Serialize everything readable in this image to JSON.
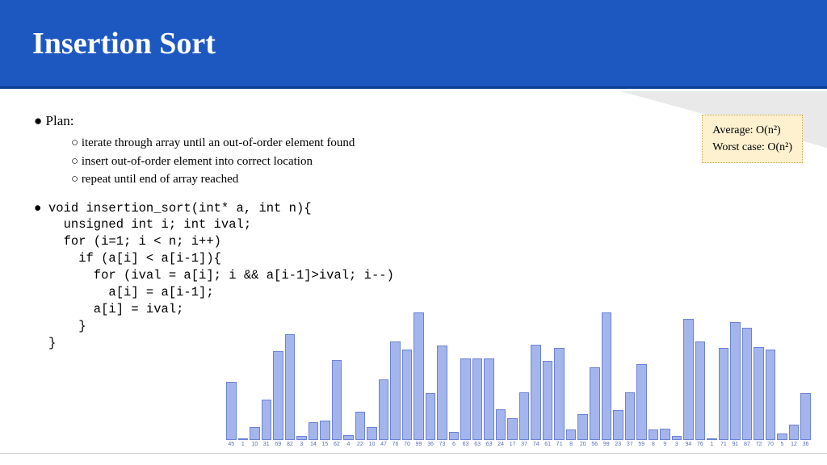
{
  "header": {
    "title": "Insertion Sort"
  },
  "plan": {
    "heading": "Plan:",
    "items": [
      "iterate through array until an out-of-order element found",
      "insert out-of-order element into correct location",
      "repeat until end of array reached"
    ]
  },
  "code": {
    "line1": "void insertion_sort(int* a, int n){",
    "line2": "  unsigned int i; int ival;",
    "line3": "  for (i=1; i < n; i++)",
    "line4": "    if (a[i] < a[i-1]){",
    "line5": "      for (ival = a[i]; i && a[i-1]>ival; i--)",
    "line6": "        a[i] = a[i-1];",
    "line7": "      a[i] = ival;",
    "line8": "    }",
    "line9": "}"
  },
  "complexity": {
    "avg": "Average: O(n²)",
    "worst": "Worst case: O(n²)"
  },
  "chart_data": {
    "type": "bar",
    "title": "",
    "xlabel": "",
    "ylabel": "",
    "ylim": [
      0,
      100
    ],
    "categories": [
      "45",
      "1",
      "10",
      "31",
      "69",
      "82",
      "3",
      "14",
      "15",
      "62",
      "4",
      "22",
      "10",
      "47",
      "76",
      "70",
      "99",
      "36",
      "73",
      "6",
      "63",
      "63",
      "63",
      "24",
      "17",
      "37",
      "74",
      "61",
      "71",
      "8",
      "20",
      "56",
      "99",
      "23",
      "37",
      "59",
      "8",
      "9",
      "3",
      "94",
      "76",
      "1",
      "71",
      "91",
      "87",
      "72",
      "70",
      "5",
      "12",
      "36"
    ],
    "values": [
      45,
      1,
      10,
      31,
      69,
      82,
      3,
      14,
      15,
      62,
      4,
      22,
      10,
      47,
      76,
      70,
      99,
      36,
      73,
      6,
      63,
      63,
      63,
      24,
      17,
      37,
      74,
      61,
      71,
      8,
      20,
      56,
      99,
      23,
      37,
      59,
      8,
      9,
      3,
      94,
      76,
      1,
      71,
      91,
      87,
      72,
      70,
      5,
      12,
      36
    ]
  }
}
